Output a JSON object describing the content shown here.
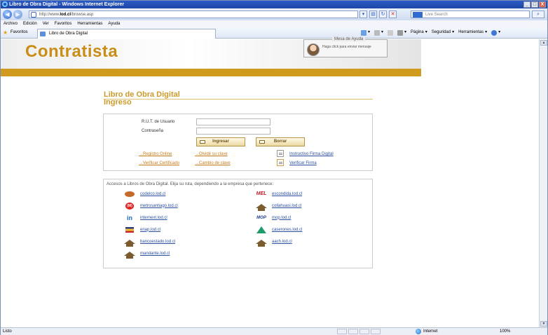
{
  "window": {
    "title": "Libro de Obra Digital - Windows Internet Explorer",
    "buttons": [
      "_",
      "□",
      "X"
    ]
  },
  "address": {
    "url_prefix": "http://www.",
    "url_bold": "lod.cl",
    "url_suffix": "/browse.asp",
    "search_placeholder": "Live Search",
    "search_go_icon": "search-icon"
  },
  "menu": [
    "Archivo",
    "Edición",
    "Ver",
    "Favoritos",
    "Herramientas",
    "Ayuda"
  ],
  "favorites": {
    "label": "Favoritos",
    "tab_title": "Libro de Obra Digital"
  },
  "commandbar": {
    "page": "Página",
    "safety": "Seguridad",
    "tools": "Herramientas"
  },
  "banner": {
    "brand": "Contratista",
    "help_title": "Mesa de Ayuda",
    "help_text": "Haga click para enviar mensaje"
  },
  "page": {
    "title": "Libro de Obra Digital",
    "subtitle": "Ingreso"
  },
  "login": {
    "rut_label": "R.U.T. de Usuario",
    "password_label": "Contraseña",
    "rut_value": "",
    "password_value": "",
    "login_button": "Ingresar",
    "clear_button": "Borrar",
    "links": {
      "register": "Registro Online",
      "forgot": "Olvidé su clave",
      "instructivo": "Instructivo Firma Digital",
      "verify_cert": "Verificar Certificado",
      "change_pwd": "Cambio de clave",
      "verify_sig": "Verificar Firma"
    }
  },
  "companies": {
    "intro": "Accesos a Libros de Obra Digital. Elija su ruta, dependiendo a la empresa que pertenece:",
    "left": [
      {
        "name": "codelco.lod.cl",
        "logo": "codelco-logo"
      },
      {
        "name": "metrosantiago.lod.cl",
        "logo": "metro-logo",
        "logo_text": "(M)"
      },
      {
        "name": "internext.lod.cl",
        "logo": "internext-logo",
        "logo_text": "in"
      },
      {
        "name": "enap.lod.cl",
        "logo": "enap-logo"
      },
      {
        "name": "bancoestado.lod.cl",
        "logo": "house-icon"
      },
      {
        "name": "mandante.lod.cl",
        "logo": "house-icon"
      }
    ],
    "right": [
      {
        "name": "escondida.lod.cl",
        "logo": "mel-logo",
        "logo_text": "MEL"
      },
      {
        "name": "collahuasi.lod.cl",
        "logo": "house-icon"
      },
      {
        "name": "mop.lod.cl",
        "logo": "mop-logo",
        "logo_text": "MOP"
      },
      {
        "name": "caserones.lod.cl",
        "logo": "caserones-logo"
      },
      {
        "name": "aach.lod.cl",
        "logo": "house-icon"
      }
    ]
  },
  "status": {
    "left": "Listo",
    "zone": "Internet",
    "zoom": "100%"
  }
}
